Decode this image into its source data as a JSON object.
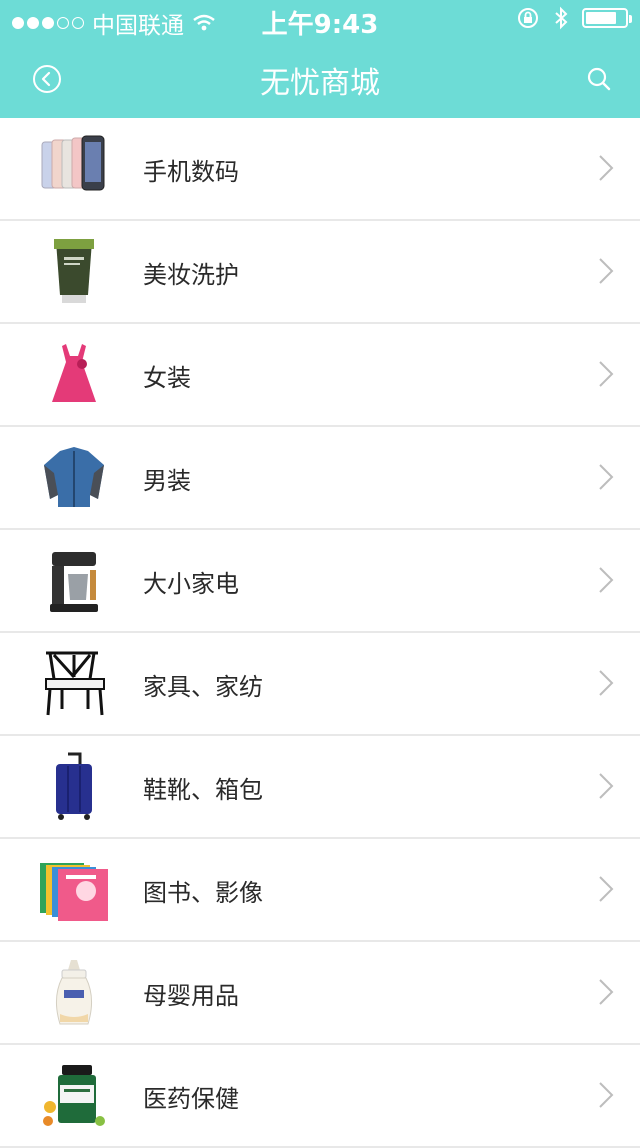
{
  "status_bar": {
    "carrier": "中国联通",
    "time": "上午9:43"
  },
  "nav": {
    "title": "无忧商城"
  },
  "categories": [
    {
      "label": "手机数码",
      "icon": "smartphones-thumbnail"
    },
    {
      "label": "美妆洗护",
      "icon": "skincare-tube-thumbnail"
    },
    {
      "label": "女装",
      "icon": "pink-dress-thumbnail"
    },
    {
      "label": "男装",
      "icon": "blue-jacket-thumbnail"
    },
    {
      "label": "大小家电",
      "icon": "coffee-maker-thumbnail"
    },
    {
      "label": "家具、家纺",
      "icon": "chair-thumbnail"
    },
    {
      "label": "鞋靴、箱包",
      "icon": "suitcase-thumbnail"
    },
    {
      "label": "图书、影像",
      "icon": "books-thumbnail"
    },
    {
      "label": "母婴用品",
      "icon": "baby-bottle-thumbnail"
    },
    {
      "label": "医药保健",
      "icon": "supplement-bottle-thumbnail"
    }
  ],
  "colors": {
    "header": "#6ddcd6",
    "divider": "#e8e8e8",
    "chevron": "#bdbdbd"
  }
}
